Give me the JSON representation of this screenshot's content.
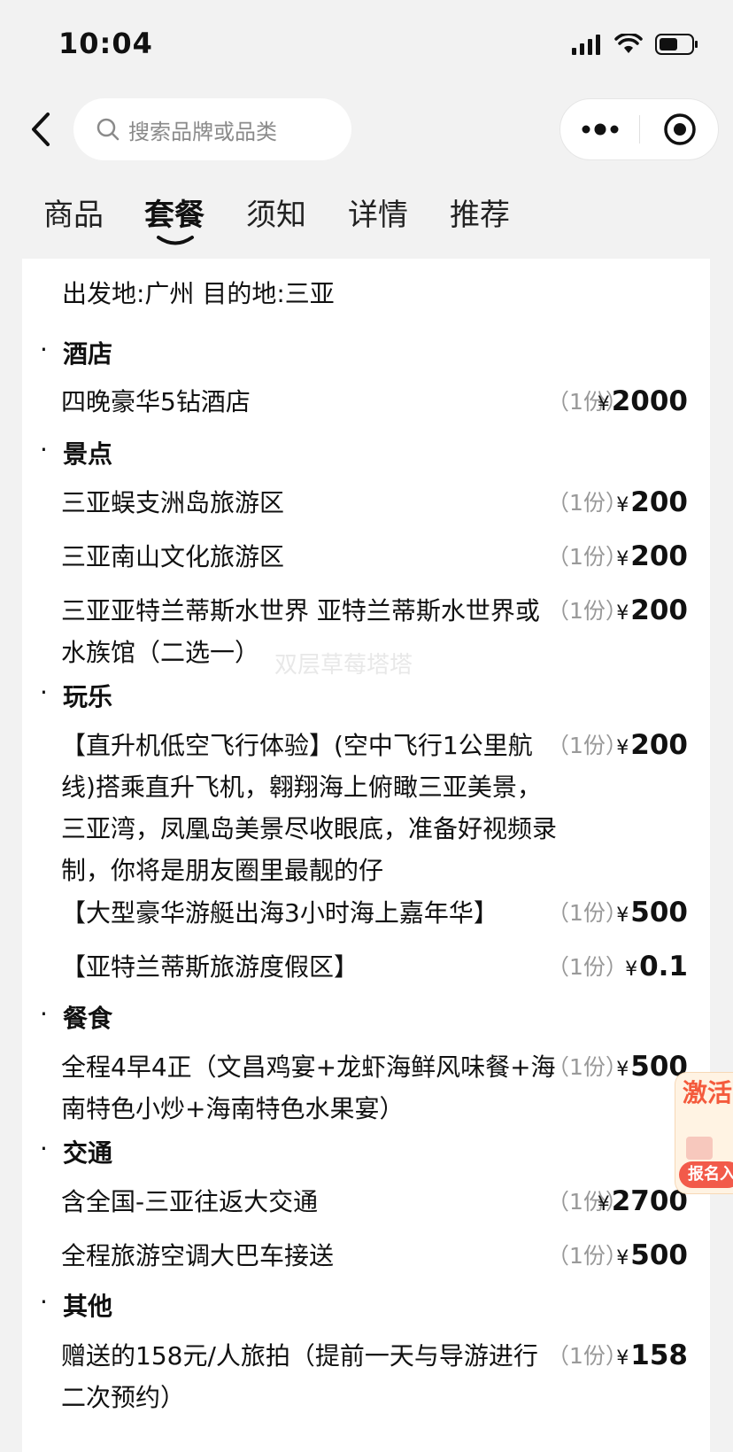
{
  "status_bar": {
    "time": "10:04"
  },
  "search": {
    "placeholder": "搜索品牌或品类"
  },
  "tabs": [
    {
      "label": "商品",
      "active": false
    },
    {
      "label": "套餐",
      "active": true
    },
    {
      "label": "须知",
      "active": false
    },
    {
      "label": "详情",
      "active": false
    },
    {
      "label": "推荐",
      "active": false
    }
  ],
  "package": {
    "origin": "出发地:广州 目的地:三亚",
    "yen": "¥",
    "qty_label": "（1份）",
    "sections": [
      {
        "title": "酒店",
        "items": [
          {
            "name": "四晚豪华5钻酒店",
            "qty": "（1份）",
            "price": "2000"
          }
        ]
      },
      {
        "title": "景点",
        "items": [
          {
            "name": "三亚蜈支洲岛旅游区",
            "qty": "（1份）",
            "price": "200"
          },
          {
            "name": "三亚南山文化旅游区",
            "qty": "（1份）",
            "price": "200"
          },
          {
            "name": "三亚亚特兰蒂斯水世界 亚特兰蒂斯水世界或水族馆（二选一）",
            "qty": "（1份）",
            "price": "200"
          }
        ]
      },
      {
        "title": "玩乐",
        "items": [
          {
            "name": "【直升机低空飞行体验】(空中飞行1公里航线)搭乘直升飞机，翱翔海上俯瞰三亚美景，三亚湾，凤凰岛美景尽收眼底，准备好视频录制，你将是朋友圈里最靓的仔",
            "qty": "（1份）",
            "price": "200"
          },
          {
            "name": "【大型豪华游艇出海3小时海上嘉年华】",
            "qty": "（1份）",
            "price": "500"
          },
          {
            "name": "【亚特兰蒂斯旅游度假区】",
            "qty": "（1份）",
            "price": "0.1"
          }
        ]
      },
      {
        "title": "餐食",
        "items": [
          {
            "name": "全程4早4正（文昌鸡宴+龙虾海鲜风味餐+海南特色小炒+海南特色水果宴）",
            "qty": "（1份）",
            "price": "500"
          }
        ]
      },
      {
        "title": "交通",
        "items": [
          {
            "name": "含全国-三亚往返大交通",
            "qty": "（1份）",
            "price": "2700"
          },
          {
            "name": "全程旅游空调大巴车接送",
            "qty": "（1份）",
            "price": "500"
          }
        ]
      },
      {
        "title": "其他",
        "items": [
          {
            "name": "赠送的158元/人旅拍（提前一天与导游进行二次预约）",
            "qty": "（1份）",
            "price": "158"
          }
        ]
      }
    ]
  },
  "watermark": "双层草莓塔塔",
  "float_badge": {
    "title": "激活",
    "button": "报名入"
  },
  "colors": {
    "accent": "#f45a3c",
    "background": "#f2f2f2",
    "muted": "#999999"
  }
}
